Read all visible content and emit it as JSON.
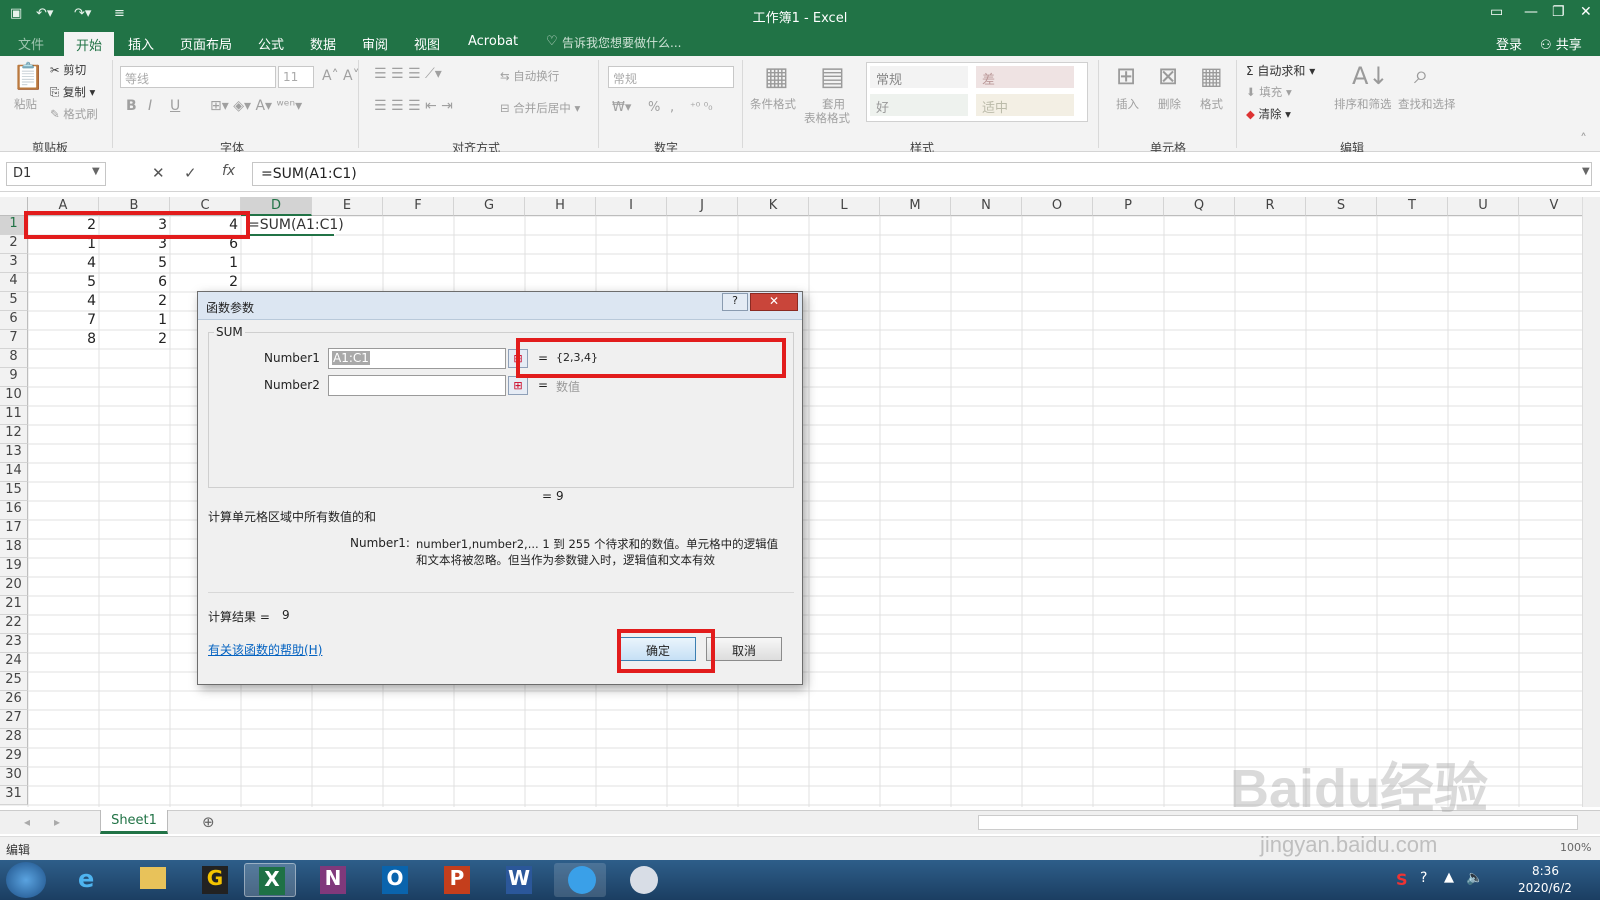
{
  "app": {
    "window_title": "工作簿1 - Excel"
  },
  "tabs": [
    "文件",
    "开始",
    "插入",
    "页面布局",
    "公式",
    "数据",
    "审阅",
    "视图",
    "Acrobat"
  ],
  "tell_me": "告诉我您想要做什么...",
  "account": {
    "login": "登录",
    "share": "共享"
  },
  "ribbon": {
    "clipboard": {
      "paste": "粘贴",
      "cut": "剪切",
      "copy": "复制",
      "painter": "格式刷",
      "group": "剪贴板"
    },
    "font": {
      "name": "等线",
      "size": "11",
      "bold": "B",
      "italic": "I",
      "underline": "U",
      "group": "字体"
    },
    "align": {
      "wrap": "自动换行",
      "merge": "合并后居中",
      "group": "对齐方式"
    },
    "number": {
      "format": "常规",
      "percent": "%",
      "comma": ",",
      "group": "数字"
    },
    "styles": {
      "conditional": "条件格式",
      "table1": "套用",
      "table2": "表格格式",
      "normal": "常规",
      "bad": "差",
      "good": "好",
      "neutral": "适中",
      "group": "样式"
    },
    "cells": {
      "insert": "插入",
      "delete": "删除",
      "format": "格式",
      "group": "单元格"
    },
    "edit": {
      "autosum": "自动求和",
      "fill": "填充",
      "clear": "清除",
      "sort": "排序和筛选",
      "find": "查找和选择",
      "group": "编辑"
    }
  },
  "formula_bar": {
    "name_box": "D1",
    "formula": "=SUM(A1:C1)",
    "fx": "fx"
  },
  "columns": [
    "A",
    "B",
    "C",
    "D",
    "E",
    "F",
    "G",
    "H",
    "I",
    "J",
    "K",
    "L",
    "M",
    "N",
    "O",
    "P",
    "Q",
    "R",
    "S",
    "T",
    "U",
    "V"
  ],
  "rows": [
    "1",
    "2",
    "3",
    "4",
    "5",
    "6",
    "7",
    "8",
    "9",
    "10",
    "11",
    "12",
    "13",
    "14",
    "15",
    "16",
    "17",
    "18",
    "19",
    "20",
    "21",
    "22",
    "23",
    "24",
    "25",
    "26",
    "27",
    "28",
    "29",
    "30",
    "31"
  ],
  "cells": [
    [
      "2",
      "3",
      "4"
    ],
    [
      "1",
      "3",
      "6"
    ],
    [
      "4",
      "5",
      "1"
    ],
    [
      "5",
      "6",
      "2"
    ],
    [
      "4",
      "2",
      ""
    ],
    [
      "7",
      "1",
      ""
    ],
    [
      "8",
      "2",
      ""
    ]
  ],
  "d1_text": "=SUM(A1:C1)",
  "dialog": {
    "title": "函数参数",
    "function_name": "SUM",
    "arg1_label": "Number1",
    "arg1_value": "A1:C1",
    "arg1_result": "{2,3,4}",
    "arg2_label": "Number2",
    "arg2_value": "",
    "arg2_result": "数值",
    "equals": "=",
    "total": "9",
    "description": "计算单元格区域中所有数值的和",
    "help_label": "Number1:",
    "help_text_1": "number1,number2,...  1 到 255 个待求和的数值。单元格中的逻辑值",
    "help_text_2": "和文本将被忽略。但当作为参数键入时，逻辑值和文本有效",
    "result_label": "计算结果 =",
    "result_value": "9",
    "help_link": "有关该函数的帮助(H)",
    "ok": "确定",
    "cancel": "取消"
  },
  "sheet_tab": "Sheet1",
  "status": {
    "mode": "编辑",
    "zoom": "100%"
  },
  "watermark": "Baidu经验",
  "watermark_url": "jingyan.baidu.com",
  "clock": {
    "time": "8:36",
    "date": "2020/6/2"
  },
  "colors": {
    "excel_green": "#217346",
    "highlight": "#e21c1c"
  }
}
